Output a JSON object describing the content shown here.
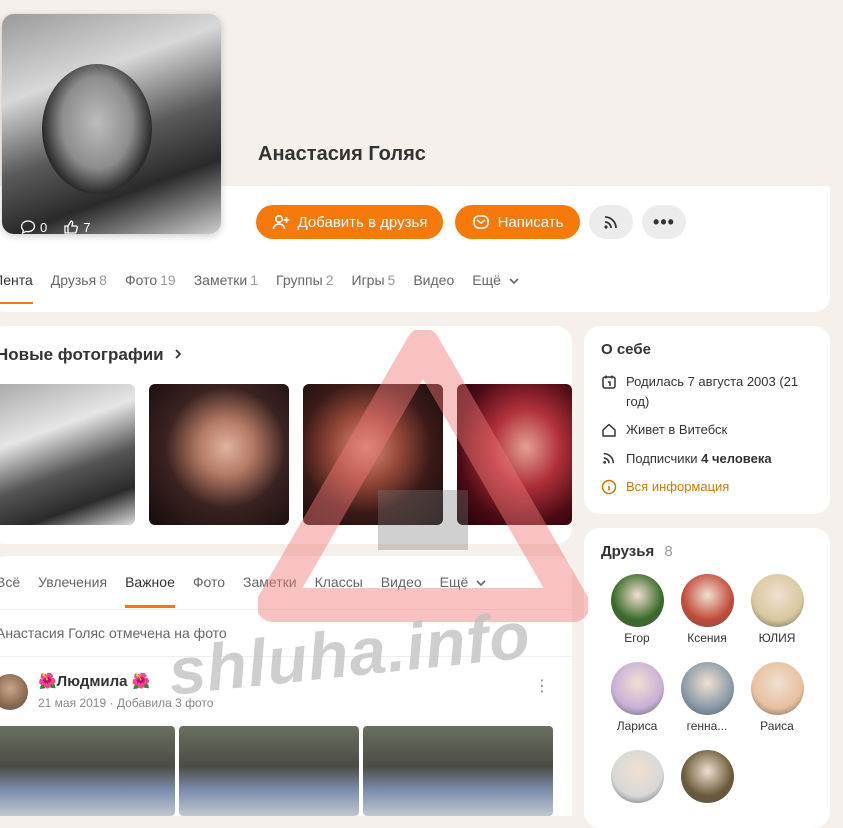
{
  "profile": {
    "name": "Анастасия Голяс",
    "comments_count": "0",
    "likes_count": "7",
    "add_friend_label": "Добавить в друзья",
    "write_label": "Написать"
  },
  "profile_tabs": [
    {
      "label": "Лента",
      "count": ""
    },
    {
      "label": "Друзья",
      "count": "8"
    },
    {
      "label": "Фото",
      "count": "19"
    },
    {
      "label": "Заметки",
      "count": "1"
    },
    {
      "label": "Группы",
      "count": "2"
    },
    {
      "label": "Игры",
      "count": "5"
    },
    {
      "label": "Видео",
      "count": ""
    },
    {
      "label": "Ещё",
      "count": ""
    }
  ],
  "new_photos": {
    "title": "Новые фотографии"
  },
  "feed": {
    "tabs": [
      "Всё",
      "Увлечения",
      "Важное",
      "Фото",
      "Заметки",
      "Классы",
      "Видео",
      "Ещё"
    ],
    "notice": "Анастасия Голяс отмечена на фото",
    "post": {
      "author": "🌺Людмила 🌺",
      "date": "21 мая 2019",
      "action": "Добавила 3 фото",
      "separator": "·"
    }
  },
  "about": {
    "title": "О себе",
    "birth": "Родилась 7 августа 2003 (21 год)",
    "city": "Живет в Витебск",
    "subscribers_label": "Подписчики",
    "subscribers_value": "4 человека",
    "all_info": "Вся информация"
  },
  "friends": {
    "title": "Друзья",
    "count": "8",
    "list": [
      {
        "name": "Егор",
        "color": "#3a6a2a"
      },
      {
        "name": "Ксения",
        "color": "#c24a3a"
      },
      {
        "name": "ЮЛИЯ",
        "color": "#d8c8a0"
      },
      {
        "name": "Лариса",
        "color": "#c8b0d8"
      },
      {
        "name": "генна...",
        "color": "#8a9aa8"
      },
      {
        "name": "Раиса",
        "color": "#e8c0a0"
      },
      {
        "name": "",
        "color": "#d8d8d8"
      },
      {
        "name": "",
        "color": "#6a5a3a"
      }
    ]
  },
  "watermark": {
    "text": "shluha.info"
  },
  "colors": {
    "accent": "#f7790a",
    "background": "#f5f0eb",
    "link": "#c9780e"
  }
}
